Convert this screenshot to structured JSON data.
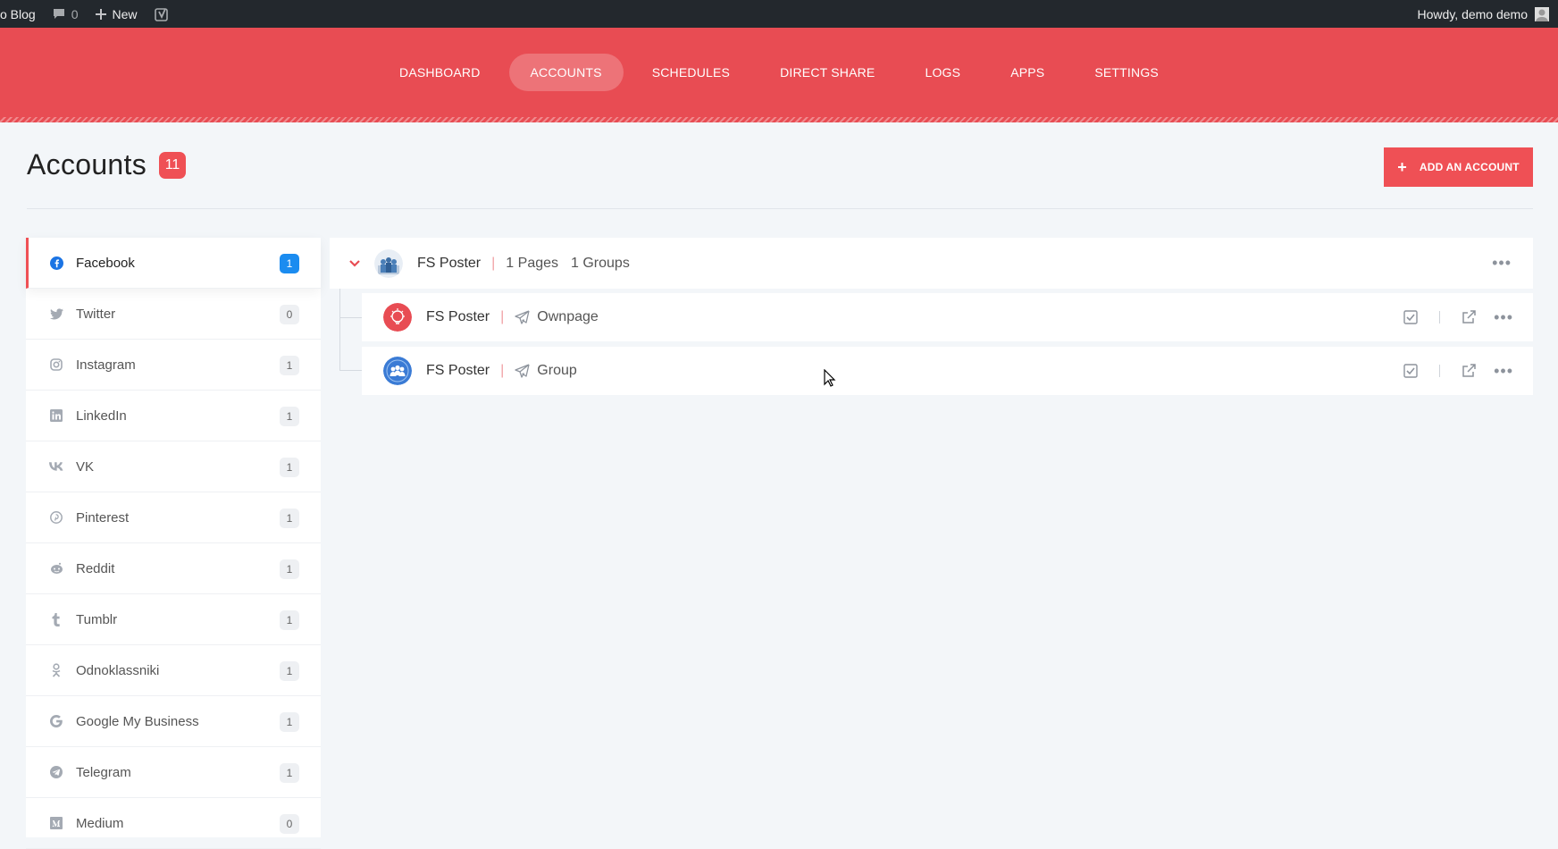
{
  "admin_bar": {
    "site_name": "o Blog",
    "comments_count": "0",
    "new_label": "New",
    "greeting": "Howdy, demo demo"
  },
  "nav": {
    "items": [
      {
        "label": "DASHBOARD",
        "active": false
      },
      {
        "label": "ACCOUNTS",
        "active": true
      },
      {
        "label": "SCHEDULES",
        "active": false
      },
      {
        "label": "DIRECT SHARE",
        "active": false
      },
      {
        "label": "LOGS",
        "active": false
      },
      {
        "label": "APPS",
        "active": false
      },
      {
        "label": "SETTINGS",
        "active": false
      }
    ]
  },
  "page": {
    "title": "Accounts",
    "total_count": "11",
    "add_button_label": "ADD AN ACCOUNT"
  },
  "colors": {
    "brand": "#e84c53",
    "accent_blue": "#1b8cf0"
  },
  "sidebar": {
    "items": [
      {
        "label": "Facebook",
        "count": "1",
        "icon": "facebook-icon",
        "active": true
      },
      {
        "label": "Twitter",
        "count": "0",
        "icon": "twitter-icon",
        "active": false
      },
      {
        "label": "Instagram",
        "count": "1",
        "icon": "instagram-icon",
        "active": false
      },
      {
        "label": "LinkedIn",
        "count": "1",
        "icon": "linkedin-icon",
        "active": false
      },
      {
        "label": "VK",
        "count": "1",
        "icon": "vk-icon",
        "active": false
      },
      {
        "label": "Pinterest",
        "count": "1",
        "icon": "pinterest-icon",
        "active": false
      },
      {
        "label": "Reddit",
        "count": "1",
        "icon": "reddit-icon",
        "active": false
      },
      {
        "label": "Tumblr",
        "count": "1",
        "icon": "tumblr-icon",
        "active": false
      },
      {
        "label": "Odnoklassniki",
        "count": "1",
        "icon": "odnoklassniki-icon",
        "active": false
      },
      {
        "label": "Google My Business",
        "count": "1",
        "icon": "google-icon",
        "active": false
      },
      {
        "label": "Telegram",
        "count": "1",
        "icon": "telegram-icon",
        "active": false
      },
      {
        "label": "Medium",
        "count": "0",
        "icon": "medium-icon",
        "active": false
      }
    ]
  },
  "account": {
    "name": "FS Poster",
    "pages": "1 Pages",
    "groups": "1 Groups",
    "nodes": [
      {
        "name": "FS Poster",
        "type": "Ownpage"
      },
      {
        "name": "FS Poster",
        "type": "Group"
      }
    ]
  }
}
